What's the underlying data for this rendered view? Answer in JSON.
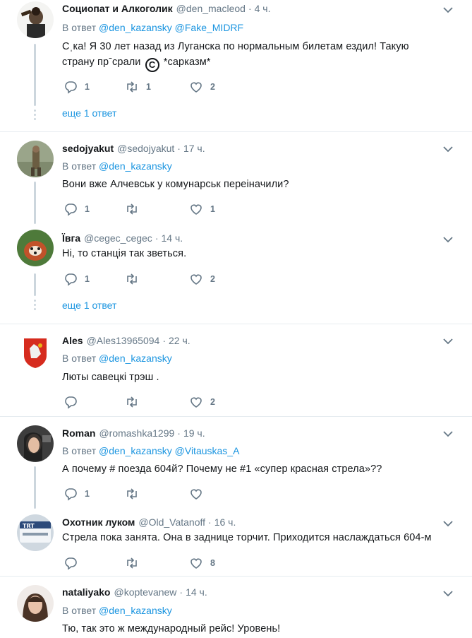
{
  "common": {
    "dot": "·",
    "in_reply_to": "В ответ"
  },
  "tweets": [
    {
      "name": "Социопат и Алкоголик",
      "handle": "@den_macleod",
      "time": "4 ч.",
      "reply_to": [
        "@den_kazansky",
        "@Fake_MIDRF"
      ],
      "text_a": "Сˌка! Я 30 лет назад из Луганска по нормальным билетам ездил! Такую страну прˉсрали",
      "copyright_glyph": "C",
      "text_b": " *сарказм*",
      "replies": "1",
      "retweets": "1",
      "likes": "2",
      "more": "еще 1 ответ"
    },
    {
      "name": "sedojyakut",
      "handle": "@sedojyakut",
      "time": "17 ч.",
      "reply_to": [
        "@den_kazansky"
      ],
      "text": "Вони вже Алчевськ у комунарськ переіначили?",
      "replies": "1",
      "retweets": "",
      "likes": "1"
    },
    {
      "name": "Ївга",
      "handle": "@cegec_cegec",
      "time": "14 ч.",
      "text": "Ні, то станція так зветься.",
      "replies": "1",
      "retweets": "",
      "likes": "2",
      "more": "еще 1 ответ"
    },
    {
      "name": "Ales",
      "handle": "@Ales13965094",
      "time": "22 ч.",
      "reply_to": [
        "@den_kazansky"
      ],
      "text": "Люты савецкі трэш .",
      "replies": "",
      "retweets": "",
      "likes": "2"
    },
    {
      "name": "Roman",
      "handle": "@romashka1299",
      "time": "19 ч.",
      "reply_to": [
        "@den_kazansky",
        "@Vitauskas_A"
      ],
      "text": "А почему # поезда 604й? Почему не #1 «супер красная стрела»??",
      "replies": "1",
      "retweets": "",
      "likes": ""
    },
    {
      "name": "Охотник луком",
      "handle": "@Old_Vatanoff",
      "time": "16 ч.",
      "text": "Стрела пока занята. Она в заднице торчит. Приходится наслаждаться 604-м",
      "replies": "",
      "retweets": "",
      "likes": "8"
    },
    {
      "name": "nataliyako",
      "handle": "@koptevanew",
      "time": "14 ч.",
      "reply_to": [
        "@den_kazansky"
      ],
      "text": "Тю, так это ж международный рейс! Уровень!"
    }
  ],
  "colors": {
    "text": "#14171a",
    "secondary": "#657786",
    "link": "#1b95e0",
    "border": "#e6ecf0",
    "thread": "#ccd6dd"
  }
}
